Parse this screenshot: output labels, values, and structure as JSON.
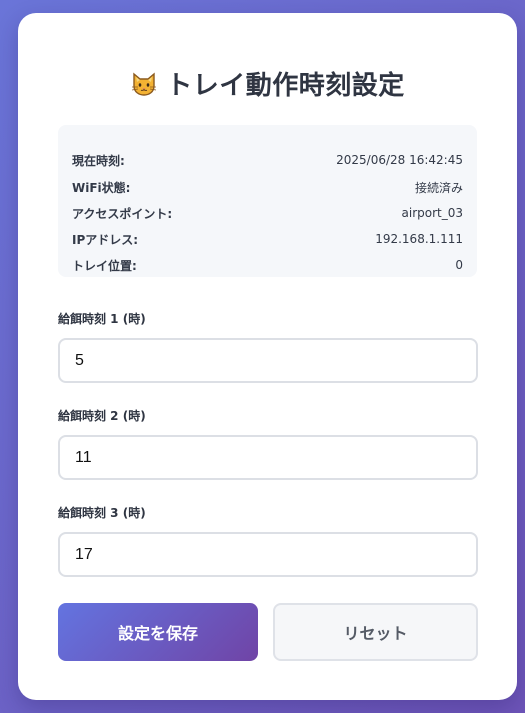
{
  "header": {
    "title": "トレイ動作時刻設定",
    "icon": "cat-face-icon"
  },
  "status": [
    {
      "label": "現在時刻:",
      "value": "2025/06/28 16:42:45"
    },
    {
      "label": "WiFi状態:",
      "value": "接続済み"
    },
    {
      "label": "アクセスポイント:",
      "value": "airport_03"
    },
    {
      "label": "IPアドレス:",
      "value": "192.168.1.111"
    },
    {
      "label": "トレイ位置:",
      "value": "0"
    }
  ],
  "feeding": [
    {
      "label": "給餌時刻 1 (時)",
      "value": "5"
    },
    {
      "label": "給餌時刻 2 (時)",
      "value": "11"
    },
    {
      "label": "給餌時刻 3 (時)",
      "value": "17"
    }
  ],
  "buttons": {
    "save_label": "設定を保存",
    "reset_label": "リセット"
  },
  "colors": {
    "background_start": "#6a75d8",
    "background_end": "#6d54b8",
    "card": "#ffffff",
    "save_gradient_start": "#6374e0",
    "save_gradient_end": "#7044a6"
  }
}
